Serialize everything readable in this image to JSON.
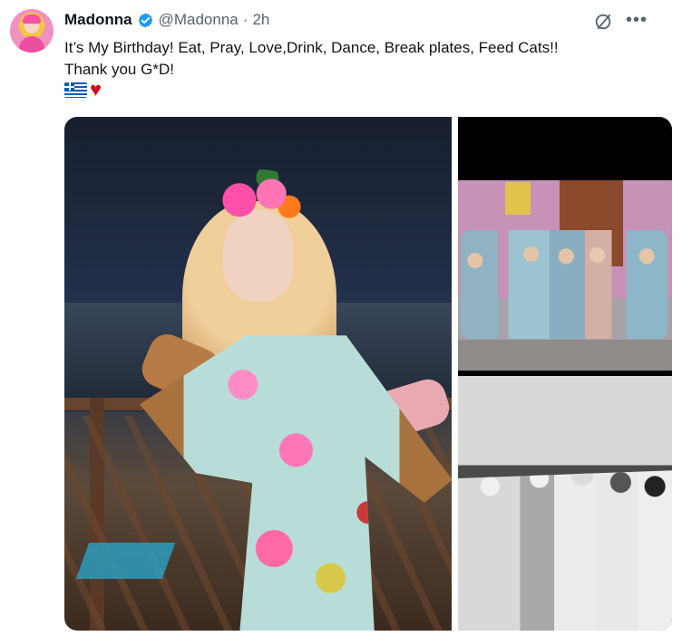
{
  "tweet": {
    "author_name": "Madonna",
    "handle": "@Madonna",
    "separator": "·",
    "time": "2h",
    "text_line_1": "It’s My Birthday! Eat, Pray, Love,Drink, Dance, Break plates, Feed Cats!!",
    "text_line_2": "Thank you G*D!",
    "emoji_1": "greek-flag",
    "emoji_2": "red-heart",
    "more_label": "•••",
    "media_count": 3
  },
  "icons": [
    "verified-badge-icon",
    "grok-icon",
    "more-options-icon"
  ],
  "colors": {
    "text": "#0f1419",
    "muted": "#536471",
    "verified": "#1d9bf0",
    "heart": "#d10b22"
  }
}
